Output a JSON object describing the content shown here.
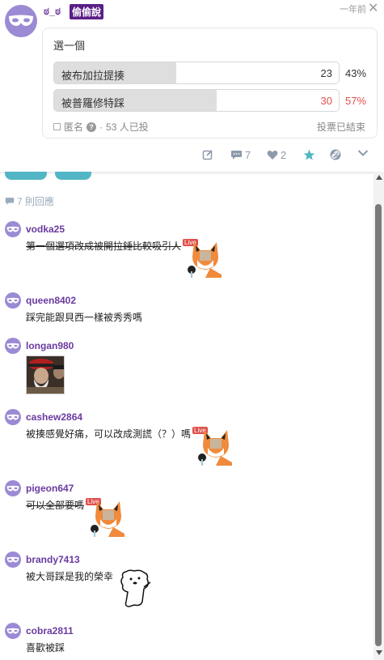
{
  "post": {
    "author": "ಠ_ಠ",
    "badge": "偷偷說",
    "time": "一年前",
    "close_glyph": "✕"
  },
  "poll": {
    "title": "選一個",
    "options": [
      {
        "label": "被布加拉提揍",
        "count": "23",
        "percent": "43%",
        "fill": 0.43
      },
      {
        "label": "被普羅修特踩",
        "count": "30",
        "percent": "57%",
        "fill": 0.57
      }
    ],
    "anonymous_label": "匿名",
    "voters": "53 人已投",
    "status": "投票已結束",
    "winner_color": "#e0504c"
  },
  "actions": {
    "comment_count": "7",
    "like_count": "2"
  },
  "comments_header": {
    "reply_count": "7 則回應"
  },
  "comments": [
    {
      "name": "vodka25",
      "text": "第一個選項改成被開拉錘比較吸引人",
      "live": "Live"
    },
    {
      "name": "queen8402",
      "text": "踩完能跟貝西一樣被秀秀嗎"
    },
    {
      "name": "longan980",
      "text": ""
    },
    {
      "name": "cashew2864",
      "text": "被揍感覺好痛，可以改成測謊（？）嗎",
      "live": "Live"
    },
    {
      "name": "pigeon647",
      "text": "可以全部要嗎",
      "live": "Live"
    },
    {
      "name": "brandy7413",
      "text": "被大哥踩是我的榮幸"
    },
    {
      "name": "cobra2811",
      "text": "喜歡被踩"
    }
  ],
  "colors": {
    "username": "#6a3aa0",
    "avatar": "#9b8ad4",
    "accent": "#52b6c6",
    "icon_gray": "#8c9aab"
  }
}
